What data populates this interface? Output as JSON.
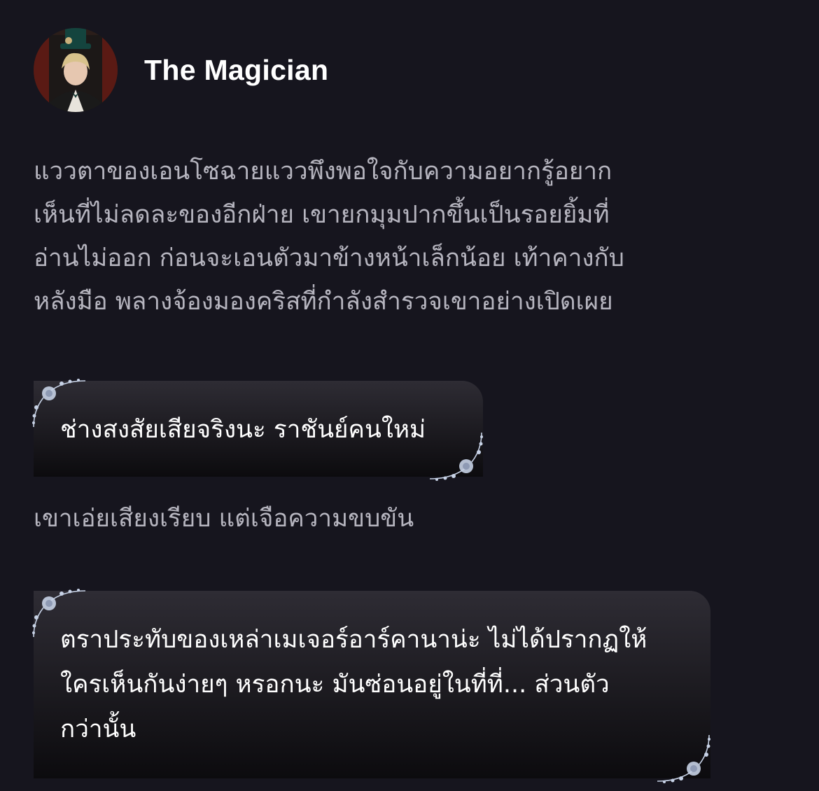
{
  "character": {
    "name": "The Magician",
    "avatar_icon": "magician-portrait-icon"
  },
  "messages": [
    {
      "type": "narration",
      "text": "แววตาของเอนโซฉายแววพึงพอใจกับความอยากรู้อยาก\nเห็นที่ไม่ลดละของอีกฝ่าย เขายกมุมปากขึ้นเป็นรอยยิ้มที่\nอ่านไม่ออก ก่อนจะเอนตัวมาข้างหน้าเล็กน้อย เท้าคางกับ\nหลังมือ พลางจ้องมองคริสที่กำลังสำรวจเขาอย่างเปิดเผย"
    },
    {
      "type": "dialogue",
      "text": "ช่างสงสัยเสียจริงนะ ราชันย์คนใหม่"
    },
    {
      "type": "narration",
      "text": "เขาเอ่ยเสียงเรียบ แต่เจือความขบขัน"
    },
    {
      "type": "dialogue",
      "text": "ตราประทับของเหล่าเมเจอร์อาร์คานาน่ะ ไม่ได้ปรากฏให้\nใครเห็นกันง่ายๆ หรอกนะ มันซ่อนอยู่ในที่ที่... ส่วนตัว\nกว่านั้น"
    }
  ],
  "colors": {
    "background": "#16151e",
    "narration_text": "#b6b5bf",
    "dialogue_text": "#ffffff",
    "name_text": "#ffffff",
    "ornament": "#c7d2e6"
  }
}
